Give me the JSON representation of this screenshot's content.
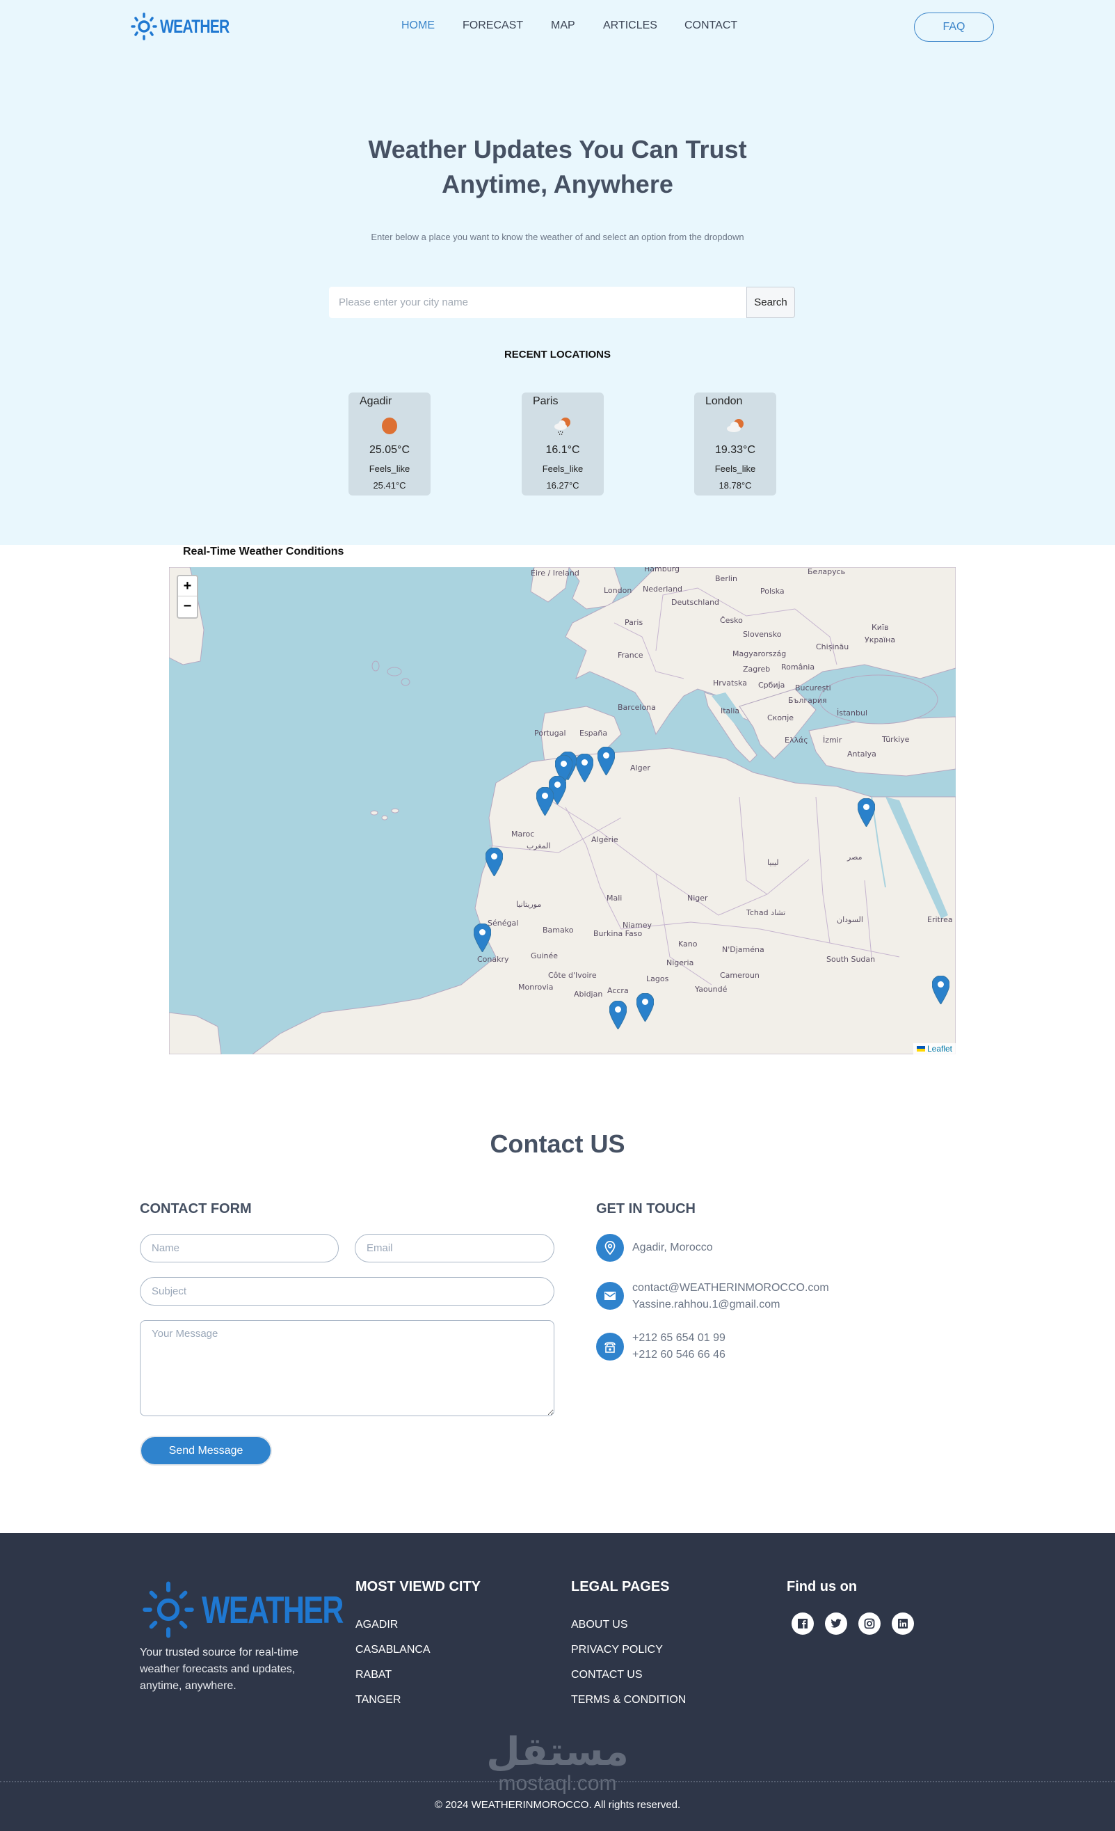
{
  "brand": {
    "name": "WEATHER",
    "color": "#1f78d1"
  },
  "nav": {
    "items": [
      {
        "label": "HOME",
        "active": true
      },
      {
        "label": "FORECAST",
        "active": false
      },
      {
        "label": "MAP",
        "active": false
      },
      {
        "label": "ARTICLES",
        "active": false
      },
      {
        "label": "CONTACT",
        "active": false
      }
    ],
    "faq_label": "FAQ"
  },
  "hero": {
    "title_line1": "Weather Updates You Can Trust",
    "title_line2": "Anytime, Anywhere",
    "subtitle": "Enter below a place you want to know the weather of and select an option from the dropdown",
    "search_placeholder": "Please enter your city name",
    "search_value": "",
    "search_button": "Search"
  },
  "recent": {
    "title": "RECENT LOCATIONS",
    "cards": [
      {
        "city": "Agadir",
        "icon": "sun-icon",
        "temp": "25.05°C",
        "feels_label": "Feels_like",
        "feels": "25.41°C"
      },
      {
        "city": "Paris",
        "icon": "cloud-sun-rain-icon",
        "temp": "16.1°C",
        "feels_label": "Feels_like",
        "feels": "16.27°C"
      },
      {
        "city": "London",
        "icon": "cloud-sun-icon",
        "temp": "19.33°C",
        "feels_label": "Feels_like",
        "feels": "18.78°C"
      }
    ]
  },
  "map": {
    "title": "Real-Time Weather Conditions",
    "zoom_in": "+",
    "zoom_out": "−",
    "attribution": "Leaflet",
    "labels": [
      "Éire / Ireland",
      "London",
      "Nederland",
      "Berlin",
      "Polska",
      "Deutschland",
      "Paris",
      "France",
      "Česko",
      "Slovensko",
      "Україна",
      "Chișinău",
      "Magyarország",
      "Zagreb",
      "România",
      "Hrvatska",
      "Србија",
      "București",
      "България",
      "Barcelona",
      "España",
      "Portugal",
      "Italia",
      "Скопје",
      "İstanbul",
      "Türkiye",
      "Ελλάς",
      "İzmir",
      "Antalya",
      "Alger",
      "Algérie",
      "Maroc",
      "المغرب",
      "موريتانيا",
      "Mali",
      "Niger",
      "Tchad تشاد",
      "Sénégal",
      "Bamako",
      "Niamey",
      "Burkina Faso",
      "Kano",
      "N'Djaména",
      "Nigeria",
      "Guinée",
      "Conakry",
      "Côte d'Ivoire",
      "Monrovia",
      "Abidjan",
      "Accra",
      "Lagos",
      "Cameroun",
      "Yaoundé",
      "South Sudan",
      "السودان",
      "Eritrea",
      "ليبيا",
      "مصر",
      "Київ",
      "Hamburg",
      "Беларусь"
    ],
    "markers": 13
  },
  "contact": {
    "title": "Contact US",
    "form_title": "CONTACT FORM",
    "name_placeholder": "Name",
    "email_placeholder": "Email",
    "subject_placeholder": "Subject",
    "message_placeholder": "Your Message",
    "send_label": "Send Message",
    "touch_title": "GET IN TOUCH",
    "address": "Agadir, Morocco",
    "email1": "contact@WEATHERINMOROCCO.com",
    "email2": "Yassine.rahhou.1@gmail.com",
    "phone1": "+212 65 654 01 99",
    "phone2": "+212 60 546 66 46"
  },
  "footer": {
    "description": "Your trusted source for real-time weather forecasts and updates, anytime, anywhere.",
    "cities_title": "MOST VIEWD CITY",
    "cities": [
      "AGADIR",
      "CASABLANCA",
      "RABAT",
      "TANGER"
    ],
    "legal_title": "LEGAL PAGES",
    "legal": [
      "ABOUT US",
      "PRIVACY POLICY",
      "CONTACT US",
      "TERMS & CONDITION"
    ],
    "social_title": "Find us on",
    "social": [
      "facebook",
      "twitter",
      "instagram",
      "linkedin"
    ],
    "watermark_ar": "مستقل",
    "watermark_lat": "mostaql.com",
    "copyright": "© 2024 WEATHERINMOROCCO. All rights reserved."
  }
}
